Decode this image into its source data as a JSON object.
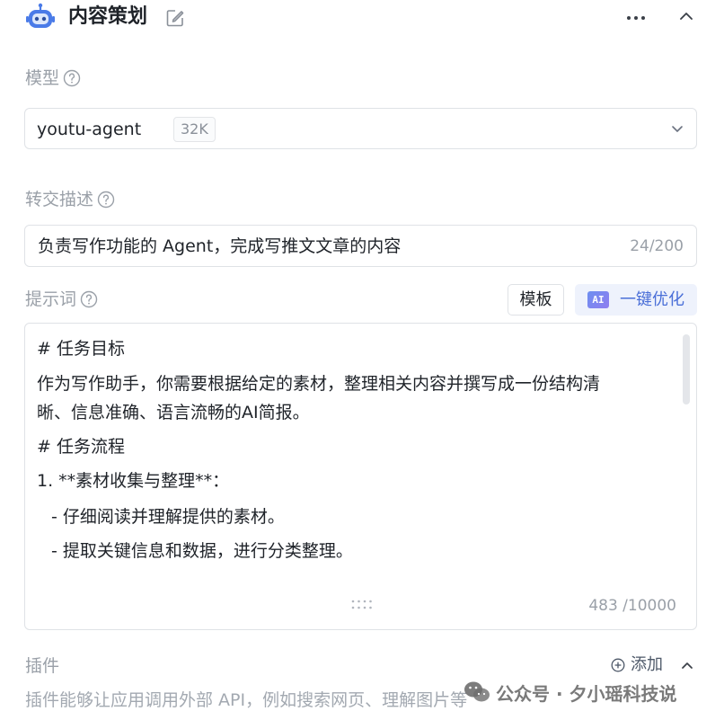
{
  "header": {
    "title": "内容策划",
    "icons": [
      "robot-icon",
      "edit-icon",
      "more-icon",
      "chevron-up-icon"
    ]
  },
  "model": {
    "label": "模型",
    "value": "youtu-agent",
    "badge": "32K"
  },
  "handoff": {
    "label": "转交描述",
    "value": "负责写作功能的 Agent，完成写推文文章的内容",
    "count": "24/200"
  },
  "prompt": {
    "label": "提示词",
    "template_button": "模板",
    "ai_badge": "AI",
    "optimize_button": "一键优化",
    "lines": [
      "# 任务目标",
      "作为写作助手，你需要根据给定的素材，整理相关内容并撰写成一份结构清",
      "晰、信息准确、语言流畅的AI简报。",
      "# 任务流程",
      "1. **素材收集与整理**：",
      "  - 仔细阅读并理解提供的素材。",
      "  - 提取关键信息和数据，进行分类整理。"
    ],
    "count": "483 /10000"
  },
  "plugins": {
    "label": "插件",
    "add_label": "添加",
    "description": "插件能够让应用调用外部 API，例如搜索网页、理解图片等"
  },
  "watermark": {
    "text": "公众号 · 夕小瑶科技说"
  },
  "colors": {
    "accent": "#4a6fd8",
    "accent_bg": "#eef2fc",
    "border": "#dfe2e6",
    "muted_text": "#9aa0a8",
    "robot_icon": "#4a7be8"
  }
}
